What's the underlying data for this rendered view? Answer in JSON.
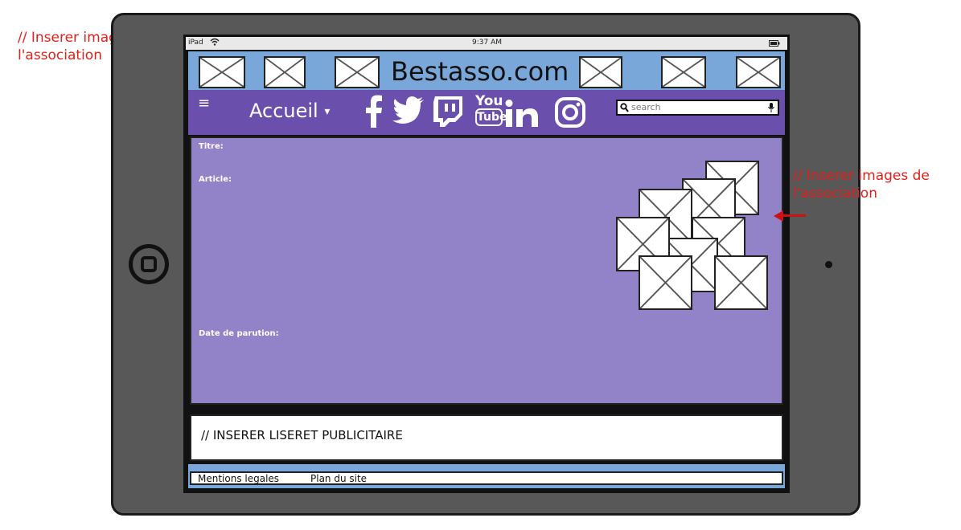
{
  "annotations": {
    "left": [
      "// Inserer images de",
      "l'association"
    ],
    "right": [
      "// Inserer images de",
      "l'association"
    ]
  },
  "status_bar": {
    "device": "iPad",
    "time": "9:37 AM",
    "wifi_icon": "wifi-icon",
    "battery_icon": "battery-icon"
  },
  "header": {
    "site_title": "Bestasso.com"
  },
  "nav": {
    "menu_icon": "≡",
    "home_label": "Accueil",
    "social": [
      "facebook-icon",
      "twitter-icon",
      "twitch-icon",
      "youtube-icon",
      "linkedin-icon",
      "instagram-icon"
    ],
    "youtube_top": "You",
    "youtube_bottom": "Tube",
    "search_placeholder": "search"
  },
  "article": {
    "title_label": "Titre:",
    "article_label": "Article:",
    "date_label": "Date de parution:"
  },
  "ad": {
    "text": "// INSERER LISERET PUBLICITAIRE"
  },
  "footer": {
    "links": [
      "Mentions legales",
      "Plan du site"
    ]
  },
  "colors": {
    "header": "#7aa7d9",
    "nav": "#6a4fad",
    "content": "#9283c8",
    "annotation": "#e0201a",
    "tablet": "#585858"
  }
}
